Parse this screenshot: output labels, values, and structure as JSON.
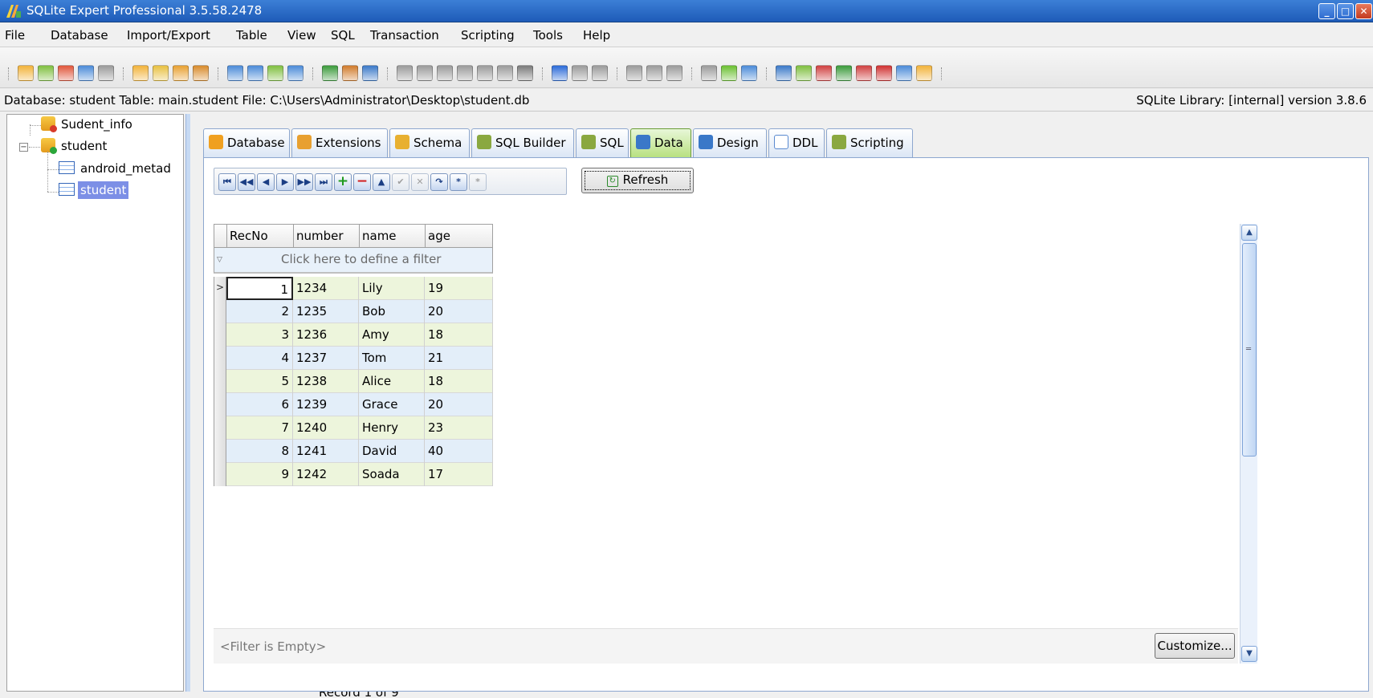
{
  "window": {
    "title": "SQLite Expert Professional 3.5.58.2478",
    "minimize": "_",
    "maximize": "□",
    "close": "✕"
  },
  "menu": [
    {
      "label": "File"
    },
    {
      "label": "Database"
    },
    {
      "label": "Import/Export"
    },
    {
      "label": "Table"
    },
    {
      "label": "View"
    },
    {
      "label": "SQL"
    },
    {
      "label": "Transaction"
    },
    {
      "label": "Scripting"
    },
    {
      "label": "Tools"
    },
    {
      "label": "Help"
    }
  ],
  "info": {
    "left": "Database: student  Table: main.student  File: C:\\Users\\Administrator\\Desktop\\student.db",
    "right": "SQLite Library: [internal] version 3.8.6"
  },
  "tree": {
    "nodes": [
      {
        "label": "Sudent_info"
      },
      {
        "label": "student"
      },
      {
        "label": "android_metad"
      },
      {
        "label": "student"
      }
    ]
  },
  "tabs": [
    {
      "label": "Database",
      "color": "#f0a020"
    },
    {
      "label": "Extensions",
      "color": "#e8a030"
    },
    {
      "label": "Schema",
      "color": "#e8b030"
    },
    {
      "label": "SQL Builder",
      "color": "#7aa030"
    },
    {
      "label": "SQL",
      "color": "#7aa030"
    },
    {
      "label": "Data",
      "color": "#3a78c8"
    },
    {
      "label": "Design",
      "color": "#3a78c8"
    },
    {
      "label": "DDL",
      "color": "#5a8ad0"
    },
    {
      "label": "Scripting",
      "color": "#7aa030"
    }
  ],
  "active_tab": "Data",
  "nav_buttons": [
    "⏮",
    "◀◀",
    "◀",
    "▶",
    "▶▶",
    "⏭",
    "+",
    "−",
    "▲",
    "✔",
    "✕",
    "↷",
    "*",
    "*"
  ],
  "refresh_label": "Refresh",
  "grid": {
    "columns": [
      "RecNo",
      "number",
      "name",
      "age"
    ],
    "filter_placeholder": "Click here to define a filter",
    "rows": [
      {
        "recno": "1",
        "number": "1234",
        "name": "Lily",
        "age": "19"
      },
      {
        "recno": "2",
        "number": "1235",
        "name": "Bob",
        "age": "20"
      },
      {
        "recno": "3",
        "number": "1236",
        "name": "Amy",
        "age": "18"
      },
      {
        "recno": "4",
        "number": "1237",
        "name": "Tom",
        "age": "21"
      },
      {
        "recno": "5",
        "number": "1238",
        "name": "Alice",
        "age": "18"
      },
      {
        "recno": "6",
        "number": "1239",
        "name": "Grace",
        "age": "20"
      },
      {
        "recno": "7",
        "number": "1240",
        "name": "Henry",
        "age": "23"
      },
      {
        "recno": "8",
        "number": "1241",
        "name": "David",
        "age": "40"
      },
      {
        "recno": "9",
        "number": "1242",
        "name": "Soada",
        "age": "17"
      }
    ],
    "filter_status": "<Filter is Empty>",
    "customize_label": "Customize..."
  },
  "status": "Record 1 of 9",
  "toolbar_icons": [
    "database-new-icon",
    "database-attach-icon",
    "database-detach-icon",
    "database-options-icon",
    "database-copy-icon",
    "table-new-icon",
    "table-edit-icon",
    "table-delete-icon",
    "table-rename-icon",
    "import-icon",
    "export-icon",
    "import-text-icon",
    "export-text-icon",
    "sql-icon",
    "bookmark-icon",
    "csv-icon",
    "script-new-icon",
    "script-open-icon",
    "script-save-icon",
    "script-run-icon",
    "script-stop-icon",
    "script-step-icon",
    "cancel-icon",
    "transaction-begin-icon",
    "transaction-commit-icon",
    "transaction-rollback-icon",
    "script-icon-a",
    "script-icon-b",
    "script-icon-c",
    "settings-icon",
    "filter-icon",
    "window-icon",
    "help-icon",
    "home-icon",
    "tools-icon",
    "edit-icon",
    "mail-icon",
    "register-icon",
    "about-icon",
    "logo-icon"
  ]
}
